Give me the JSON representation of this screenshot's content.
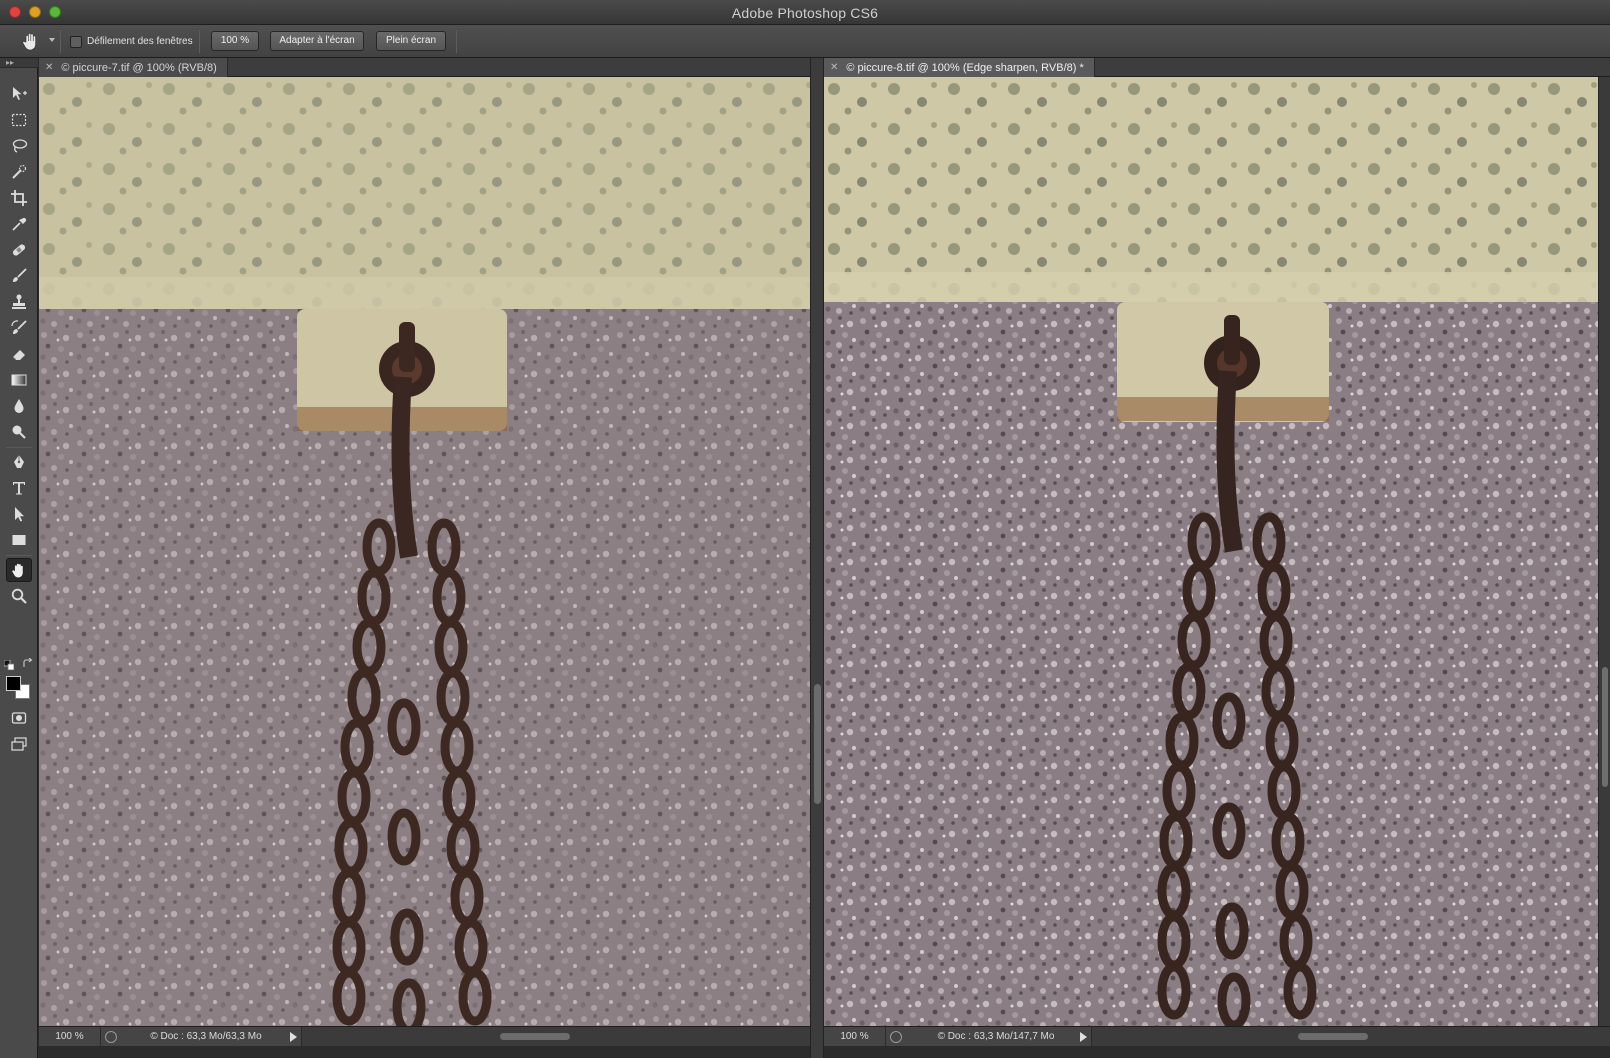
{
  "app": {
    "title": "Adobe Photoshop CS6"
  },
  "options_bar": {
    "scroll_all_windows_label": "Défilement des fenêtres",
    "scroll_all_windows_checked": false,
    "zoom_100_label": "100 %",
    "fit_screen_label": "Adapter à l'écran",
    "fill_screen_label": "Plein écran"
  },
  "tools": [
    {
      "name": "move-tool",
      "icon": "move-icon"
    },
    {
      "name": "marquee-tool",
      "icon": "rect-marquee-icon"
    },
    {
      "name": "lasso-tool",
      "icon": "lasso-icon"
    },
    {
      "name": "quick-selection-tool",
      "icon": "quick-selection-icon"
    },
    {
      "name": "crop-tool",
      "icon": "crop-icon"
    },
    {
      "name": "eyedropper-tool",
      "icon": "eyedropper-icon"
    },
    {
      "name": "healing-brush-tool",
      "icon": "bandage-icon"
    },
    {
      "name": "brush-tool",
      "icon": "brush-icon"
    },
    {
      "name": "clone-stamp-tool",
      "icon": "stamp-icon"
    },
    {
      "name": "history-brush-tool",
      "icon": "history-brush-icon"
    },
    {
      "name": "eraser-tool",
      "icon": "eraser-icon"
    },
    {
      "name": "gradient-tool",
      "icon": "gradient-icon"
    },
    {
      "name": "blur-tool",
      "icon": "drop-icon"
    },
    {
      "name": "dodge-tool",
      "icon": "dodge-icon"
    },
    {
      "name": "pen-tool",
      "icon": "pen-icon"
    },
    {
      "name": "type-tool",
      "icon": "type-icon"
    },
    {
      "name": "path-selection-tool",
      "icon": "arrow-icon"
    },
    {
      "name": "rectangle-tool",
      "icon": "rectangle-icon"
    },
    {
      "name": "hand-tool",
      "icon": "hand-icon",
      "active": true
    },
    {
      "name": "zoom-tool",
      "icon": "magnifier-icon"
    }
  ],
  "colors": {
    "foreground": "#000000",
    "background": "#ffffff"
  },
  "documents": [
    {
      "tab_title": "© piccure-7.tif @ 100% (RVB/8)",
      "zoom": "100 %",
      "doc_size": "© Doc : 63,3 Mo/63,3 Mo",
      "active": false
    },
    {
      "tab_title": "© piccure-8.tif @ 100% (Edge sharpen, RVB/8) *",
      "zoom": "100 %",
      "doc_size": "© Doc : 63,3 Mo/147,7 Mo",
      "active": true
    }
  ]
}
